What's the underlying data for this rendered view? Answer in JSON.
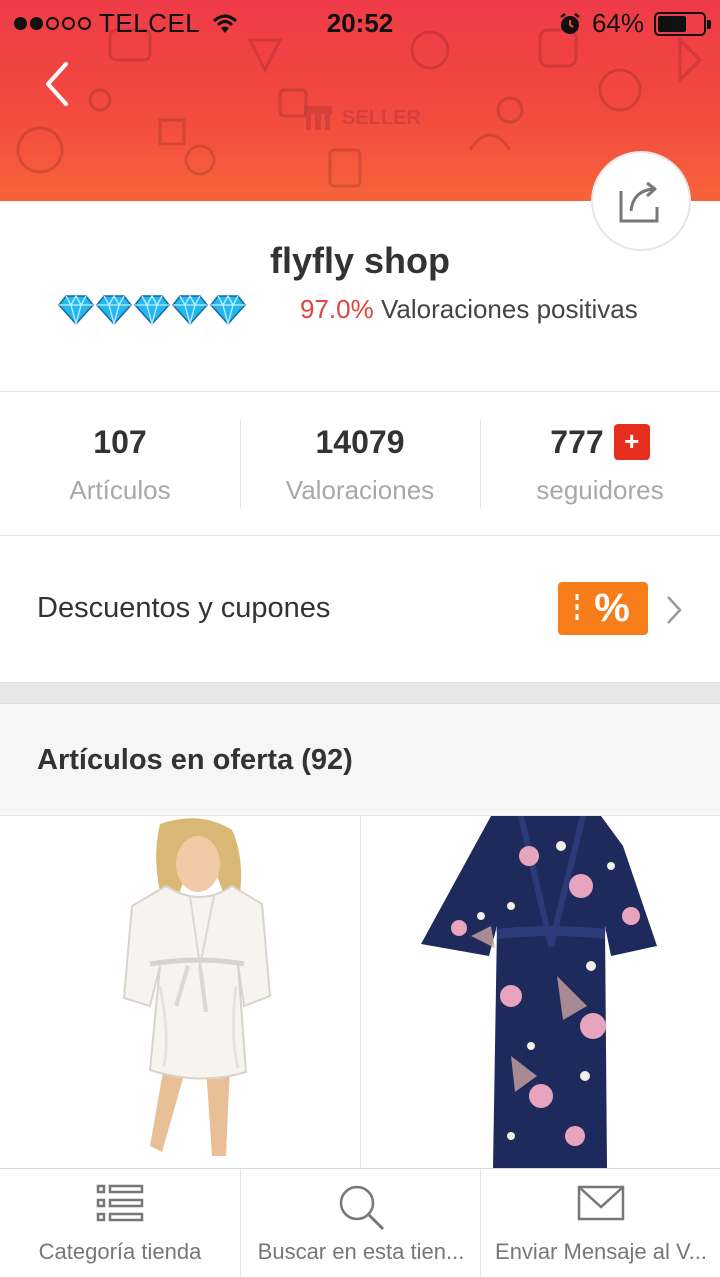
{
  "status_bar": {
    "carrier": "TELCEL",
    "time": "20:52",
    "battery": "64%",
    "battery_level": 0.64
  },
  "header": {
    "seller_label": "SELLER",
    "back_icon": "chevron-left-icon",
    "share_icon": "share-icon",
    "colors": {
      "top": "#ef3b48",
      "bottom": "#f7633a"
    }
  },
  "shop": {
    "name": "flyfly shop",
    "diamond_count": 5,
    "positive_pct": "97.0%",
    "positive_label": "Valoraciones positivas"
  },
  "stats": [
    {
      "value": "107",
      "label": "Artículos"
    },
    {
      "value": "14079",
      "label": "Valoraciones"
    },
    {
      "value": "777",
      "label": "seguidores",
      "action": "+"
    }
  ],
  "coupons": {
    "label": "Descuentos y cupones",
    "tag": "%",
    "accent": "#f67d1a"
  },
  "offers": {
    "title": "Artículos en oferta (92)"
  },
  "products": [
    {
      "image": "white satin robe",
      "color": "#f4f1ea"
    },
    {
      "image": "navy floral kimono robe",
      "color": "#1f2a5c"
    }
  ],
  "tabbar": [
    {
      "label": "Categoría tienda",
      "icon": "list-icon"
    },
    {
      "label": "Buscar en esta tien...",
      "icon": "search-icon"
    },
    {
      "label": "Enviar Mensaje al V...",
      "icon": "mail-icon"
    }
  ],
  "colors": {
    "price_red": "#e0443a",
    "follow_red": "#e62e1f",
    "diamond": "#27b7f0"
  }
}
